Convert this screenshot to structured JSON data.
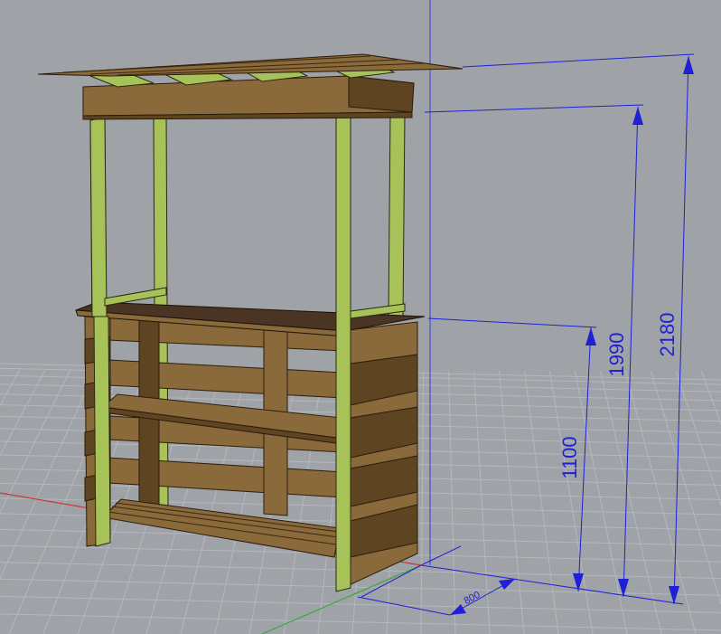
{
  "viewport": {
    "background_color": "#9fa3a8",
    "grid_color": "#b4b8bc",
    "axis_x_color": "#c23b3b",
    "axis_y_color": "#3aa83a",
    "axis_z_color": "#3a3ad6"
  },
  "model": {
    "wood_color": "#8a6a3a",
    "wood_dark_color": "#5e4420",
    "post_color": "#a8c25a",
    "top_color": "#4a3424"
  },
  "dimensions": {
    "line_color": "#1f1fd6",
    "overall_height": "2180",
    "canopy_height": "1990",
    "counter_height": "1100",
    "depth": "800"
  }
}
